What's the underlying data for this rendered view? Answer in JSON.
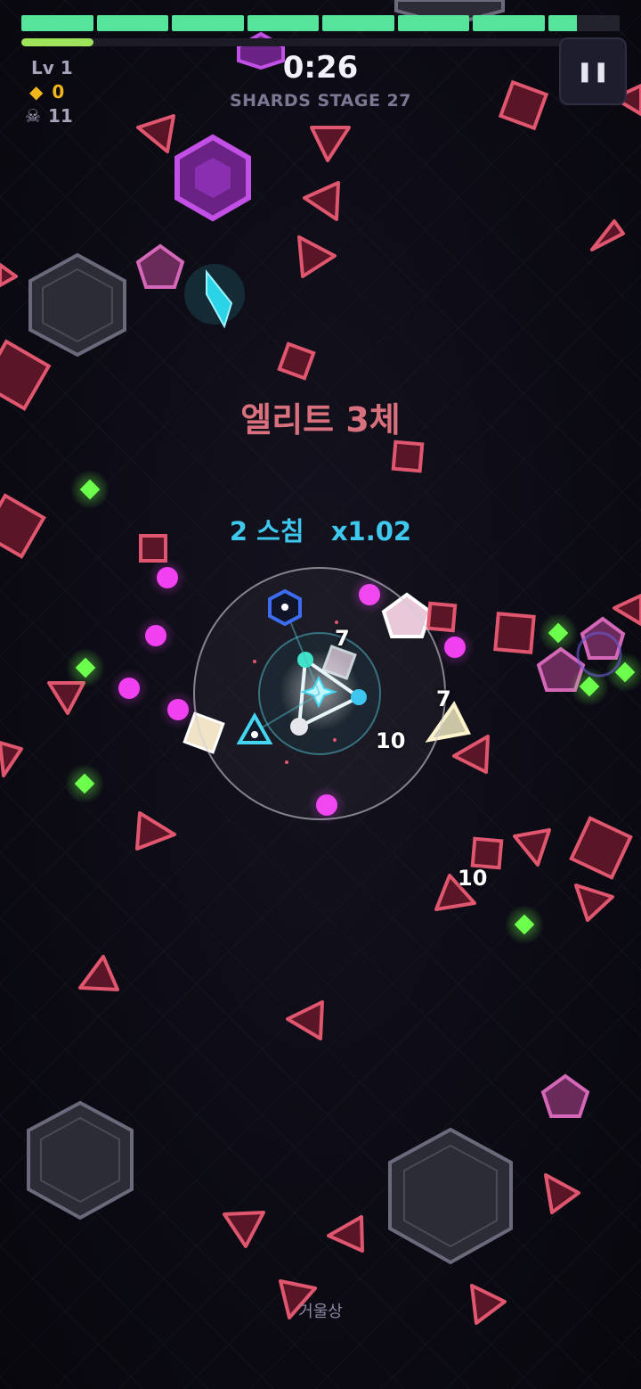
{
  "hud": {
    "hp_segments": 8,
    "hp_last_fill": 0.4,
    "xp_fraction": 0.12,
    "level": "Lv 1",
    "gems": "0",
    "kills": "11",
    "timer": "0:26",
    "stage_label": "SHARDS STAGE 27",
    "pause_icon": "pause-icon"
  },
  "events": {
    "banner": "엘리트 3체",
    "combo": "2 스침   x1.02"
  },
  "damage_numbers": [
    "7",
    "7",
    "10",
    "10"
  ],
  "footer": {
    "mirror_label": "거울상"
  },
  "colors": {
    "hp": "#56e39a",
    "xp": "#9fe35a",
    "enemy_red": "#e0566e",
    "elite_magenta": "#c24fe6",
    "player_cyan": "#44d6f0",
    "pickup_green": "#6cff4c"
  }
}
